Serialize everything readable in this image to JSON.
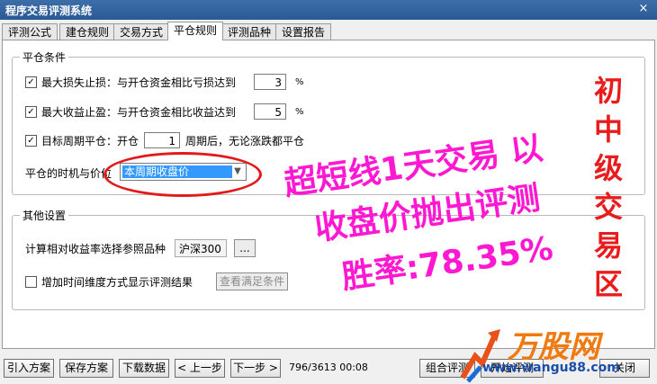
{
  "window": {
    "title": "程序交易评测系统",
    "close_icon": "×"
  },
  "tabs": [
    {
      "label": "评测公式"
    },
    {
      "label": "建仓规则"
    },
    {
      "label": "交易方式"
    },
    {
      "label": "平仓规则",
      "active": true
    },
    {
      "label": "评测品种"
    },
    {
      "label": "设置报告"
    }
  ],
  "close_group": {
    "legend": "平仓条件",
    "stop_loss": {
      "checked": true,
      "label": "最大损失止损：与开仓资金相比亏损达到",
      "value": "3",
      "unit": "%"
    },
    "take_profit": {
      "checked": true,
      "label": "最大收益止盈：与开仓资金相比收益达到",
      "value": "5",
      "unit": "%"
    },
    "target_period": {
      "checked": true,
      "label": "目标周期平仓：开仓",
      "value": "1",
      "suffix": "周期后，无论涨跌都平仓"
    },
    "timing": {
      "label": "平仓的时机与价位",
      "selected": "本周期收盘价"
    }
  },
  "other_group": {
    "legend": "其他设置",
    "reference": {
      "label": "计算相对收益率选择参照品种",
      "value": "沪深300",
      "browse": "..."
    },
    "time_dim": {
      "checked": false,
      "label": "增加时间维度方式显示评测结果",
      "button": "查看满足条件"
    }
  },
  "overlay": {
    "line1": "超短线1天交易 以",
    "line2": "收盘价抛出评测",
    "line3": "胜率:78.35%",
    "vertical": [
      "初",
      "中",
      "级",
      "交",
      "易",
      "区"
    ],
    "color": "#ff18d2"
  },
  "bottom": {
    "buttons": [
      "引入方案",
      "保存方案",
      "下载数据",
      "< 上一步",
      "下一步 >",
      "组合评测",
      "开始评测",
      "关闭"
    ],
    "status": "796/3613 00:08"
  },
  "watermark": {
    "brand": "万股网",
    "url": "www.wangu88.com"
  }
}
